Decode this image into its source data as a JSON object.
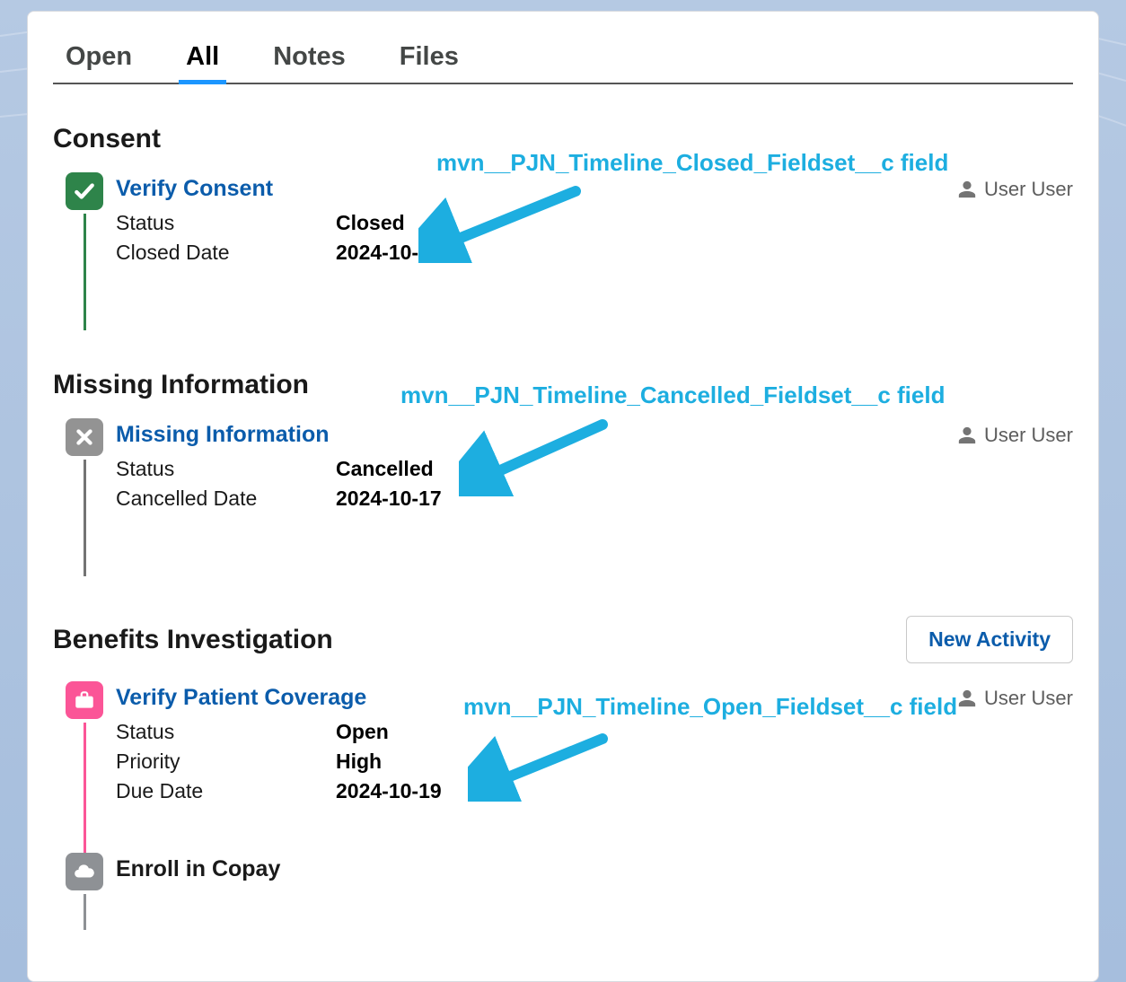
{
  "tabs": {
    "open": "Open",
    "all": "All",
    "notes": "Notes",
    "files": "Files",
    "active": "all"
  },
  "annotations": {
    "closed": "mvn__PJN_Timeline_Closed_Fieldset__c field",
    "cancelled": "mvn__PJN_Timeline_Cancelled_Fieldset__c field",
    "open": "mvn__PJN_Timeline_Open_Fieldset__c field"
  },
  "user_label": "User User",
  "new_activity_label": "New Activity",
  "sections": {
    "consent": {
      "title": "Consent",
      "item": {
        "title": "Verify Consent",
        "fields": [
          {
            "label": "Status",
            "value": "Closed"
          },
          {
            "label": "Closed Date",
            "value": "2024-10-17"
          }
        ]
      }
    },
    "missing": {
      "title": "Missing Information",
      "item": {
        "title": "Missing Information",
        "fields": [
          {
            "label": "Status",
            "value": "Cancelled"
          },
          {
            "label": "Cancelled Date",
            "value": "2024-10-17"
          }
        ]
      }
    },
    "benefits": {
      "title": "Benefits Investigation",
      "item": {
        "title": "Verify Patient Coverage",
        "fields": [
          {
            "label": "Status",
            "value": "Open"
          },
          {
            "label": "Priority",
            "value": "High"
          },
          {
            "label": "Due Date",
            "value": "2024-10-19"
          }
        ]
      },
      "item2": {
        "title": "Enroll in Copay"
      }
    }
  }
}
